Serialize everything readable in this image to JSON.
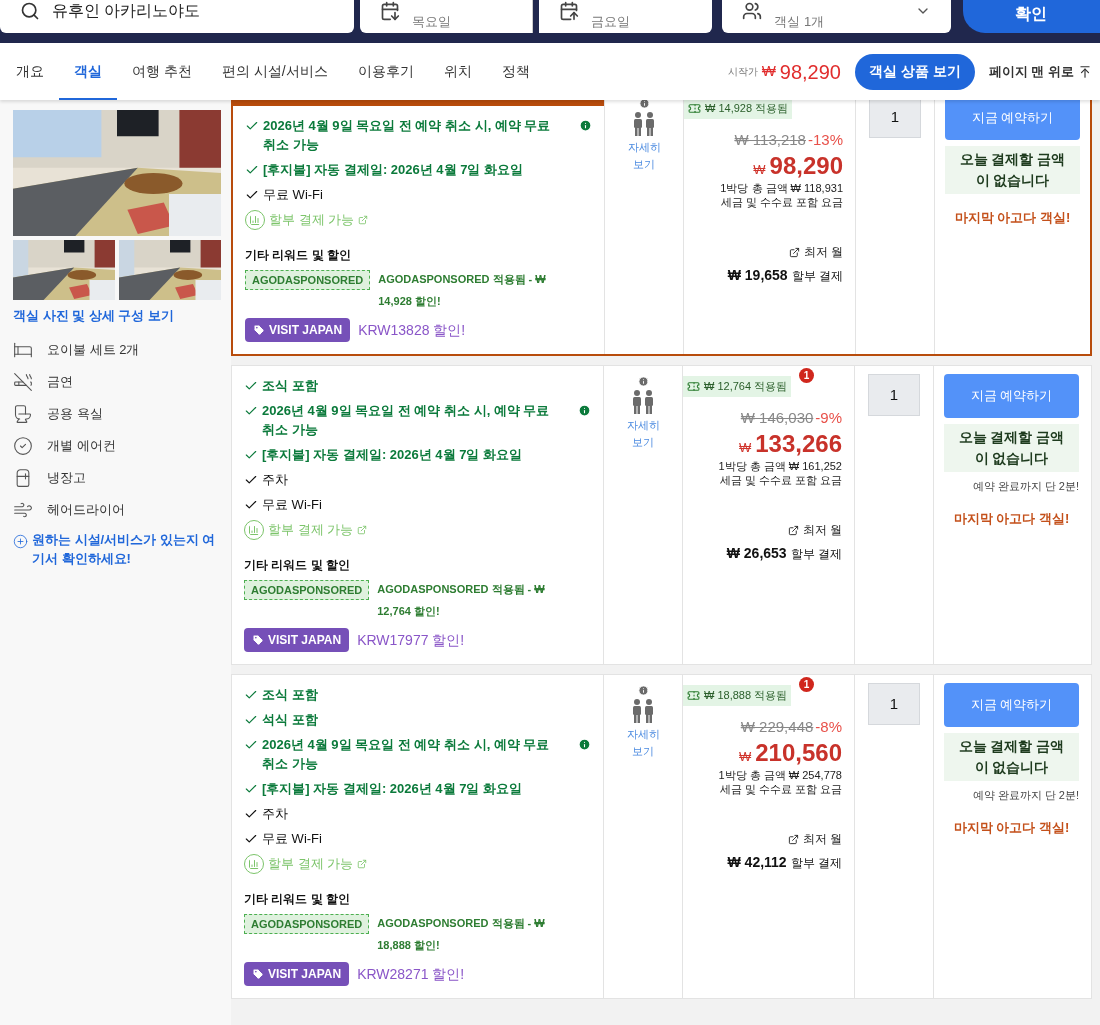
{
  "search": {
    "value": "유후인 아카리노야도"
  },
  "dates": [
    {
      "weekday": "목요일"
    },
    {
      "weekday": "금요일"
    }
  ],
  "guests": {
    "rooms": "객실 1개"
  },
  "confirm_button": "확인",
  "nav": {
    "tabs": [
      {
        "label": "개요",
        "selected": false
      },
      {
        "label": "객실",
        "selected": true
      },
      {
        "label": "여행 추천",
        "selected": false
      },
      {
        "label": "편의 시설/서비스",
        "selected": false
      },
      {
        "label": "이용후기",
        "selected": false
      },
      {
        "label": "위치",
        "selected": false
      },
      {
        "label": "정책",
        "selected": false
      }
    ],
    "price_from": {
      "label": "시작가",
      "currency": "₩",
      "amount": "98,290"
    },
    "view_button": "객실 상품 보기",
    "top_link": "페이지 맨 위로"
  },
  "room": {
    "photos_link": "객실 사진 및 상세 구성 보기",
    "amenities": [
      {
        "kind": "bed",
        "label": "요이불 세트 2개"
      },
      {
        "kind": "nosmoking",
        "label": "금연"
      },
      {
        "kind": "toilet",
        "label": "공용 욕실"
      },
      {
        "kind": "check",
        "label": "개별 에어컨"
      },
      {
        "kind": "fridge",
        "label": "냉장고"
      },
      {
        "kind": "dryer",
        "label": "헤어드라이어"
      }
    ],
    "request_link": "원하는 시설/서비스가 있는지 여기서 확인하세요!"
  },
  "offers": [
    {
      "highlighted": true,
      "features": [
        {
          "kind": "included",
          "text": "2026년 4월 9일 목요일 전 예약 취소 시, 예약 무료 취소 가능",
          "info": true
        },
        {
          "kind": "included",
          "text": "[후지불] 자동 결제일: 2026년 4월 7일 화요일",
          "info": false
        },
        {
          "kind": "plain",
          "text": "무료 Wi-Fi",
          "info": false
        }
      ],
      "installment": "할부 결제 가능",
      "rewards_title": "기타 리워드 및 할인",
      "promo_tag": "AGODASPONSORED",
      "promo_text": "AGODASPONSORED 적용됨 - ₩ 14,928 할인!",
      "coupon_label": "VISIT JAPAN",
      "coupon_text": "KRW13828 할인!",
      "detail_link": "자세히 보기",
      "applied": "₩ 14,928 적용됨",
      "original": "₩ 113,218",
      "discount": "-13%",
      "currency": "₩",
      "price": "98,290",
      "total": "1박당 총 금액 ₩ 118,931",
      "tax": "세금 및 수수료 포함 요금",
      "monthly_label": "최저 월",
      "monthly": "₩ 19,658",
      "monthly_suffix": "할부 결제",
      "quantity": "1",
      "book": "지금 예약하기",
      "pay_note": "오늘 결제할 금액이 없습니다",
      "last_room": "마지막 아고다 객실!"
    },
    {
      "highlighted": false,
      "features": [
        {
          "kind": "included",
          "text": "조식 포함",
          "info": false
        },
        {
          "kind": "included",
          "text": "2026년 4월 9일 목요일 전 예약 취소 시, 예약 무료 취소 가능",
          "info": true
        },
        {
          "kind": "included",
          "text": "[후지불] 자동 결제일: 2026년 4월 7일 화요일",
          "info": false
        },
        {
          "kind": "plain",
          "text": "주차",
          "info": false
        },
        {
          "kind": "plain",
          "text": "무료 Wi-Fi",
          "info": false
        }
      ],
      "installment": "할부 결제 가능",
      "rewards_title": "기타 리워드 및 할인",
      "promo_tag": "AGODASPONSORED",
      "promo_text": "AGODASPONSORED 적용됨 - ₩ 12,764 할인!",
      "coupon_label": "VISIT JAPAN",
      "coupon_text": "KRW17977 할인!",
      "detail_link": "자세히 보기",
      "applied": "₩ 12,764 적용됨",
      "badge": "1",
      "original": "₩ 146,030",
      "discount": "-9%",
      "currency": "₩",
      "price": "133,266",
      "total": "1박당 총 금액 ₩ 161,252",
      "tax": "세금 및 수수료 포함 요금",
      "monthly_label": "최저 월",
      "monthly": "₩ 26,653",
      "monthly_suffix": "할부 결제",
      "quantity": "1",
      "book": "지금 예약하기",
      "pay_note": "오늘 결제할 금액이 없습니다",
      "urgency": "예약 완료까지 단 2분!",
      "last_room": "마지막 아고다 객실!"
    },
    {
      "highlighted": false,
      "features": [
        {
          "kind": "included",
          "text": "조식 포함",
          "info": false
        },
        {
          "kind": "included",
          "text": "석식 포함",
          "info": false
        },
        {
          "kind": "included",
          "text": "2026년 4월 9일 목요일 전 예약 취소 시, 예약 무료 취소 가능",
          "info": true
        },
        {
          "kind": "included",
          "text": "[후지불] 자동 결제일: 2026년 4월 7일 화요일",
          "info": false
        },
        {
          "kind": "plain",
          "text": "주차",
          "info": false
        },
        {
          "kind": "plain",
          "text": "무료 Wi-Fi",
          "info": false
        }
      ],
      "installment": "할부 결제 가능",
      "rewards_title": "기타 리워드 및 할인",
      "promo_tag": "AGODASPONSORED",
      "promo_text": "AGODASPONSORED 적용됨 - ₩ 18,888 할인!",
      "coupon_label": "VISIT JAPAN",
      "coupon_text": "KRW28271 할인!",
      "detail_link": "자세히 보기",
      "applied": "₩ 18,888 적용됨",
      "badge": "1",
      "original": "₩ 229,448",
      "discount": "-8%",
      "currency": "₩",
      "price": "210,560",
      "total": "1박당 총 금액 ₩ 254,778",
      "tax": "세금 및 수수료 포함 요금",
      "monthly_label": "최저 월",
      "monthly": "₩ 42,112",
      "monthly_suffix": "할부 결제",
      "quantity": "1",
      "book": "지금 예약하기",
      "pay_note": "오늘 결제할 금액이 없습니다",
      "urgency": "예약 완료까지 단 2분!",
      "last_room": "마지막 아고다 객실!"
    }
  ]
}
